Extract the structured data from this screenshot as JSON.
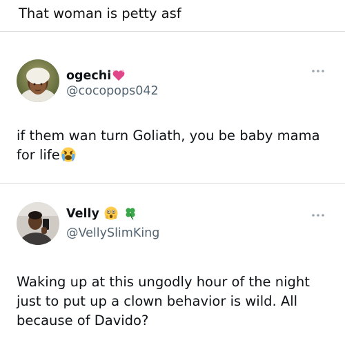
{
  "caption": "That woman is petty asf",
  "tweets": [
    {
      "display_name": "ogechi",
      "name_emoji": "sparkling-heart-icon",
      "handle": "@cocopops042",
      "text": "if them wan turn Goliath, you be baby mama for life",
      "text_emoji": "crying-face-icon"
    },
    {
      "display_name": "Velly",
      "name_emojis": [
        "astonished-face-icon",
        "four-leaf-clover-icon"
      ],
      "handle": "@VellySlimKing",
      "text": "Waking up at this ungodly hour of the night just to put up a clown behavior is wild. All because of Davido?"
    }
  ],
  "colors": {
    "text": "#0f1419",
    "secondary": "#536471",
    "divider": "#dcdcdc",
    "heart": "#e0468a",
    "clover": "#3aa84a"
  }
}
